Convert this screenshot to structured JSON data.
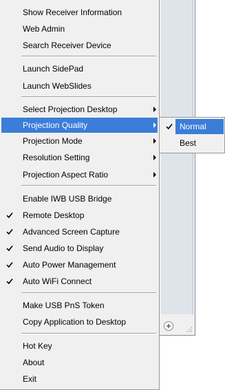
{
  "menu": {
    "groups": [
      {
        "items": [
          {
            "label": "Show Receiver Information"
          },
          {
            "label": "Web Admin"
          },
          {
            "label": "Search Receiver Device"
          }
        ]
      },
      {
        "items": [
          {
            "label": "Launch SidePad"
          },
          {
            "label": "Launch WebSlides"
          }
        ]
      },
      {
        "items": [
          {
            "label": "Select Projection Desktop",
            "submenu": true
          },
          {
            "label": "Projection Quality",
            "submenu": true,
            "highlighted": true
          },
          {
            "label": "Projection Mode",
            "submenu": true
          },
          {
            "label": "Resolution Setting",
            "submenu": true
          },
          {
            "label": "Projection Aspect Ratio",
            "submenu": true
          }
        ]
      },
      {
        "items": [
          {
            "label": "Enable IWB USB Bridge",
            "checked": false
          },
          {
            "label": "Remote Desktop",
            "checked": true
          },
          {
            "label": "Advanced Screen Capture",
            "checked": true
          },
          {
            "label": "Send Audio to Display",
            "checked": true
          },
          {
            "label": "Auto Power Management",
            "checked": true
          },
          {
            "label": "Auto WiFi Connect",
            "checked": true
          }
        ]
      },
      {
        "items": [
          {
            "label": "Make USB PnS Token"
          },
          {
            "label": "Copy Application to Desktop"
          }
        ]
      },
      {
        "items": [
          {
            "label": "Hot Key"
          },
          {
            "label": "About"
          },
          {
            "label": "Exit"
          }
        ]
      }
    ]
  },
  "submenu": {
    "items": [
      {
        "label": "Normal",
        "checked": true,
        "highlighted": true
      },
      {
        "label": "Best",
        "checked": false
      }
    ]
  },
  "icons": {
    "check": "checkmark-icon",
    "submenu_arrow": "submenu-arrow-icon",
    "add": "add-circle-icon",
    "grip": "resize-grip-icon"
  },
  "colors": {
    "menu_background": "#f0f0f0",
    "highlight": "#3b7dd8",
    "highlight_text": "#ffffff",
    "separator": "#a0a0a0"
  }
}
